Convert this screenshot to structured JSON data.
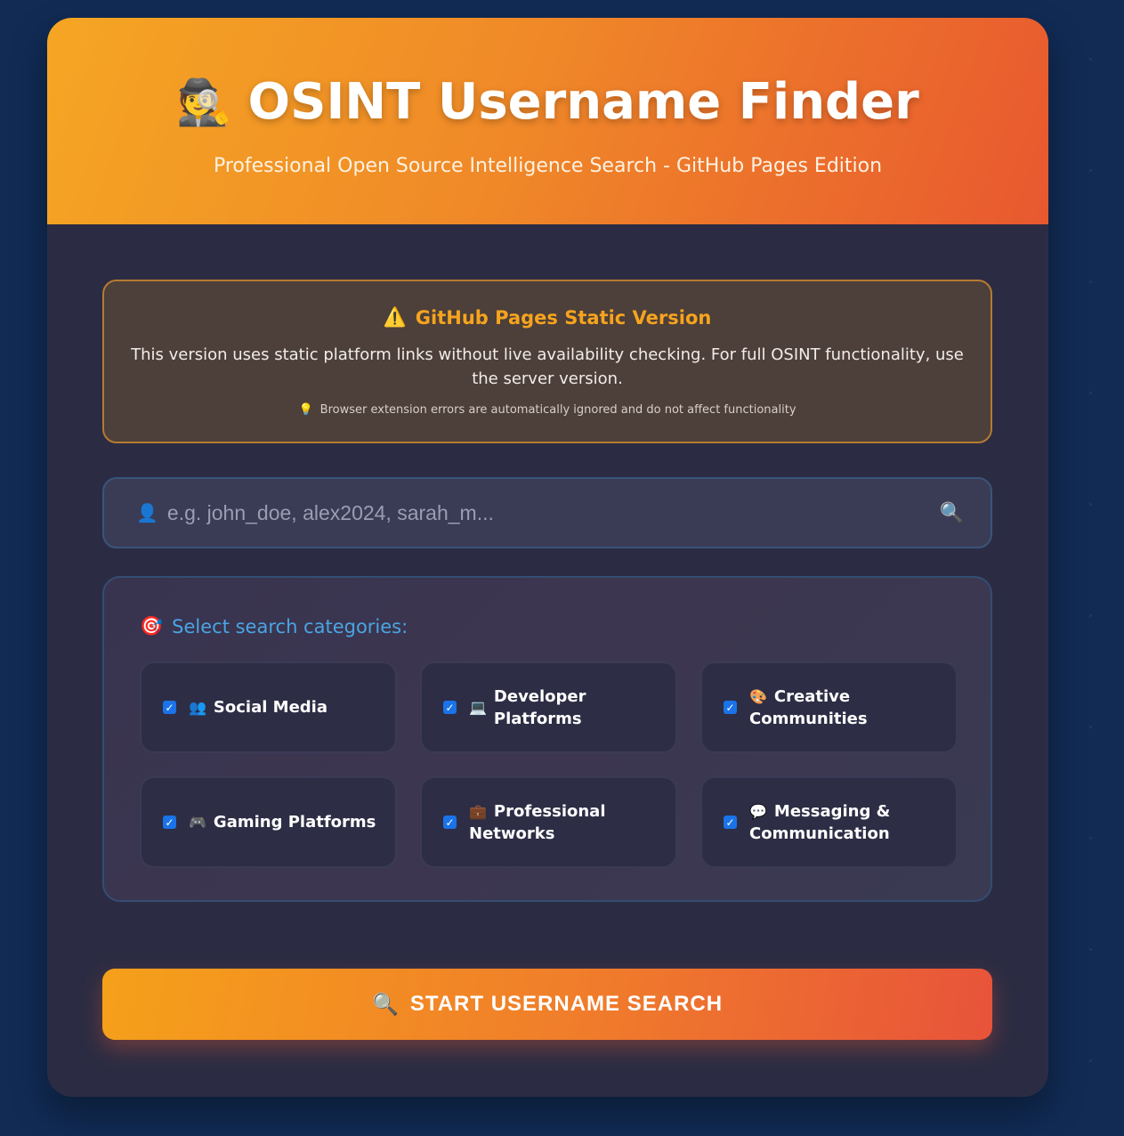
{
  "header": {
    "icon": "detective-icon",
    "title": "OSINT Username Finder",
    "subtitle": "Professional Open Source Intelligence Search - GitHub Pages Edition"
  },
  "notice": {
    "title": "GitHub Pages Static Version",
    "text": "This version uses static platform links without live availability checking. For full OSINT functionality, use the server version.",
    "tip": "Browser extension errors are automatically ignored and do not affect functionality"
  },
  "search": {
    "placeholder": "e.g. john_doe, alex2024, sarah_m..."
  },
  "categories": {
    "title": "Select search categories:",
    "items": [
      {
        "label": "Social Media",
        "checked": true,
        "icon": "people-icon"
      },
      {
        "label": "Developer Platforms",
        "checked": true,
        "icon": "laptop-icon"
      },
      {
        "label": "Creative Communities",
        "checked": true,
        "icon": "palette-icon"
      },
      {
        "label": "Gaming Platforms",
        "checked": true,
        "icon": "gamepad-icon"
      },
      {
        "label": "Professional Networks",
        "checked": true,
        "icon": "briefcase-icon"
      },
      {
        "label": "Messaging & Communication",
        "checked": true,
        "icon": "speech-bubble-icon"
      }
    ]
  },
  "button": {
    "label": "START USERNAME SEARCH"
  },
  "colors": {
    "accent": "#f5a623",
    "accent_end": "#e8533a",
    "card_bg": "#2b2c43",
    "link": "#4aa5e3"
  }
}
